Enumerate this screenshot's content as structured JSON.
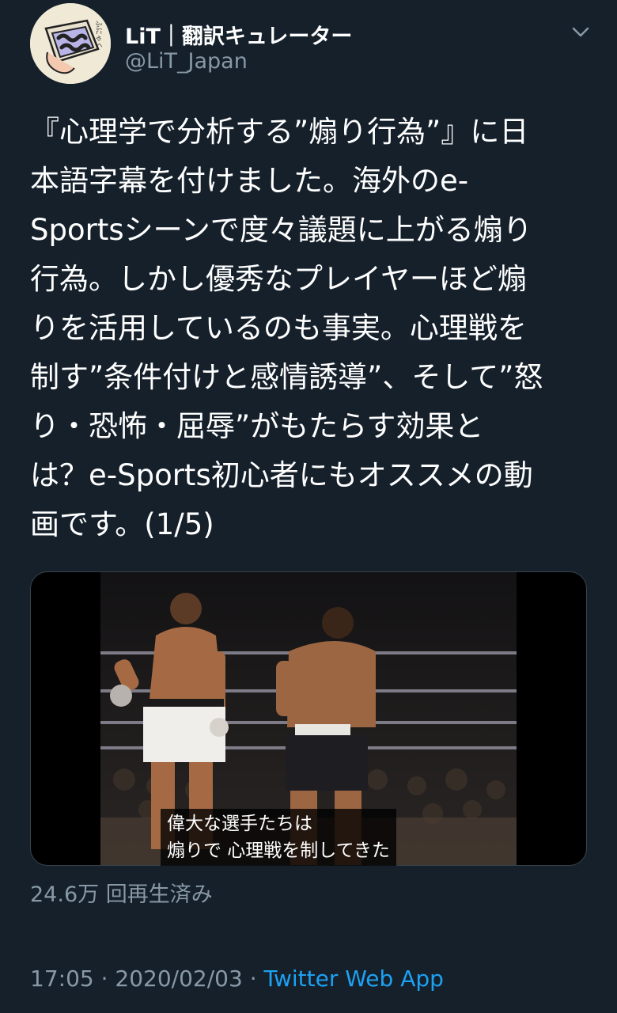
{
  "user": {
    "display_name": "LiT｜翻訳キュレーター",
    "handle": "@LiT_Japan"
  },
  "tweet": {
    "lines": [
      "『心理学で分析する”煽り行為”』に日",
      "本語字幕を付けました。海外のe-",
      "Sportsシーンで度々議題に上がる煽り",
      "行為。しかし優秀なプレイヤーほど煽",
      "りを活用しているのも事実。心理戦を",
      "制す”条件付けと感情誘導”、そして”怒",
      "り・恐怖・屈辱”がもたらす効果と",
      "は？e-Sports初心者にもオススメの動",
      "画です。(1/5)"
    ]
  },
  "media": {
    "subtitle_line1": "偉大な選手たちは",
    "subtitle_line2": "煽りで 心理戦を制してきた"
  },
  "views_text": "24.6万 回再生済み",
  "meta": {
    "time": "17:05",
    "sep1": " · ",
    "date": "2020/02/03",
    "sep2": " · ",
    "app": "Twitter Web App"
  },
  "colors": {
    "background": "#15202b",
    "secondary_text": "#8899a6",
    "link": "#1da1f2"
  }
}
